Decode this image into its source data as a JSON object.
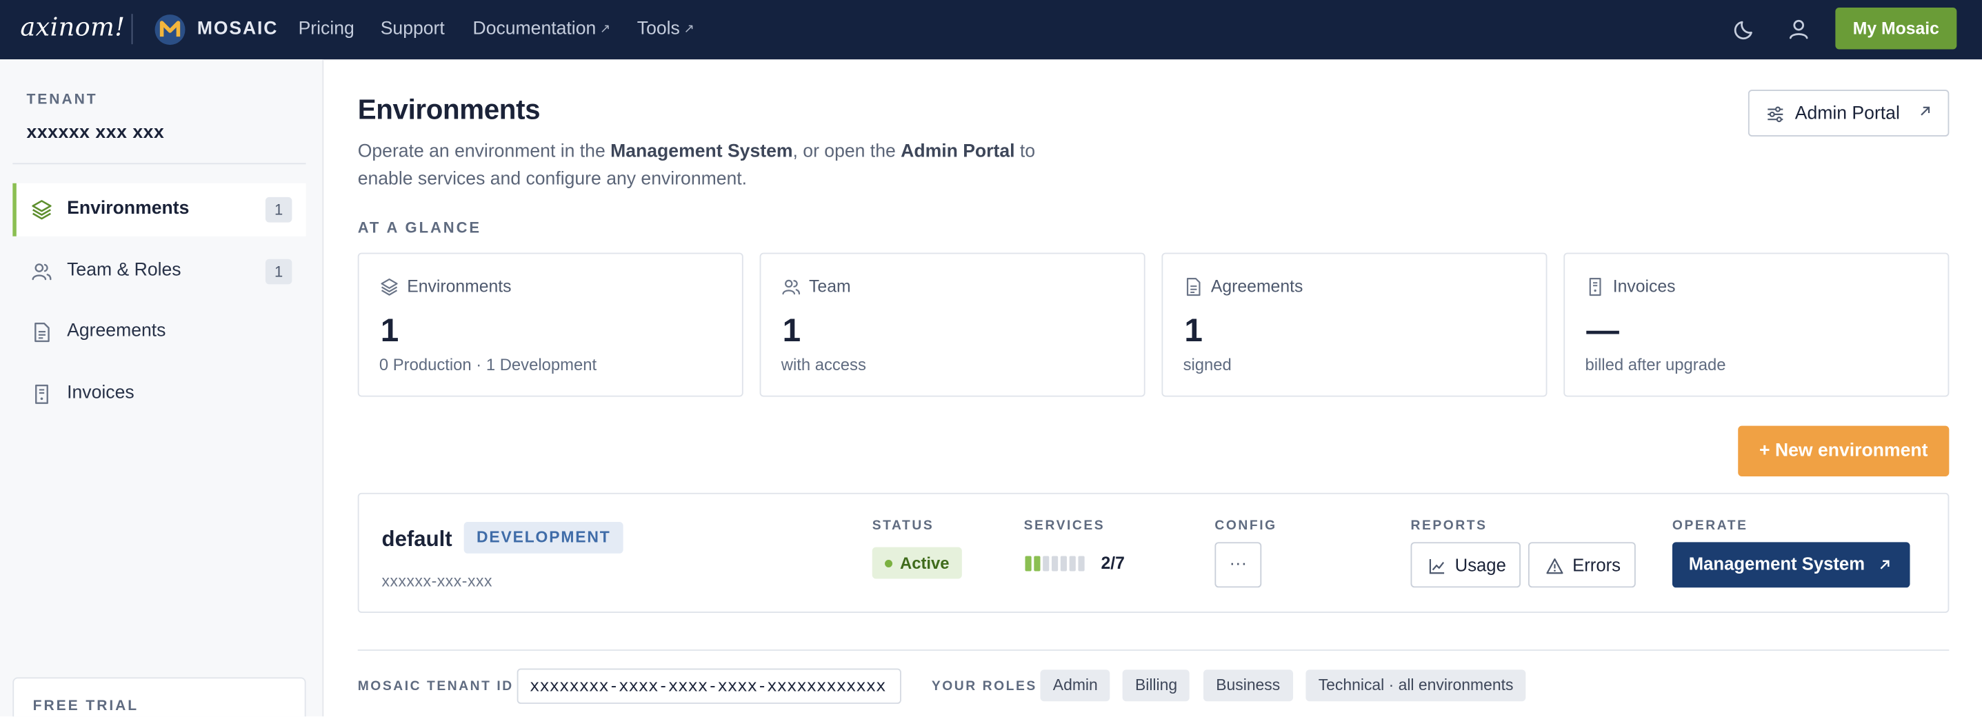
{
  "nav": {
    "brand": "axinom!",
    "product": "MOSAIC",
    "links": [
      {
        "label": "Pricing",
        "external": false
      },
      {
        "label": "Support",
        "external": false
      },
      {
        "label": "Documentation",
        "external": true
      },
      {
        "label": "Tools",
        "external": true
      }
    ],
    "cta_label": "My Mosaic",
    "accent_green": "#6a9c37",
    "bg": "#14223f"
  },
  "sidebar": {
    "tenant_label": "TENANT",
    "tenant_name": "xxxxxx xxx xxx",
    "items": [
      {
        "label": "Environments",
        "count": "1",
        "active": true,
        "icon": "layers-icon"
      },
      {
        "label": "Team & Roles",
        "count": "1",
        "active": false,
        "icon": "users-icon"
      },
      {
        "label": "Agreements",
        "count": "",
        "active": false,
        "icon": "document-icon"
      },
      {
        "label": "Invoices",
        "count": "",
        "active": false,
        "icon": "receipt-icon"
      }
    ],
    "free_trial_label": "FREE TRIAL"
  },
  "main": {
    "title": "Environments",
    "desc_pre": "Operate an environment in the ",
    "desc_bold1": "Management System",
    "desc_mid": ", or open the ",
    "desc_bold2": "Admin Portal",
    "desc_post": " to enable services and configure any environment.",
    "admin_portal_label": "Admin Portal",
    "glance_label": "AT A GLANCE",
    "cards": [
      {
        "label": "Environments",
        "value": "1",
        "sub": "0 Production · 1 Development",
        "icon": "layers-icon"
      },
      {
        "label": "Team",
        "value": "1",
        "sub": "with access",
        "icon": "users-icon"
      },
      {
        "label": "Agreements",
        "value": "1",
        "sub": "signed",
        "icon": "document-icon"
      },
      {
        "label": "Invoices",
        "value": "—",
        "sub": "billed after upgrade",
        "icon": "receipt-icon"
      }
    ],
    "new_env_label": "+ New environment",
    "env": {
      "name": "default",
      "badge": "DEVELOPMENT",
      "id": "xxxxxx-xxx-xxx",
      "status_label": "STATUS",
      "status": "Active",
      "services_label": "SERVICES",
      "services_enabled": 2,
      "services_total": 7,
      "services_text": "2/7",
      "config_label": "CONFIG",
      "config_button": "···",
      "reports_label": "REPORTS",
      "usage_label": "Usage",
      "errors_label": "Errors",
      "operate_label": "OPERATE",
      "management_label": "Management System"
    },
    "tenant_id_label": "MOSAIC TENANT ID",
    "tenant_id": "xxxxxxxx-xxxx-xxxx-xxxx-xxxxxxxxxxxx",
    "roles_label": "YOUR ROLES",
    "roles": [
      "Admin",
      "Billing",
      "Business",
      "Technical · all environments"
    ]
  }
}
